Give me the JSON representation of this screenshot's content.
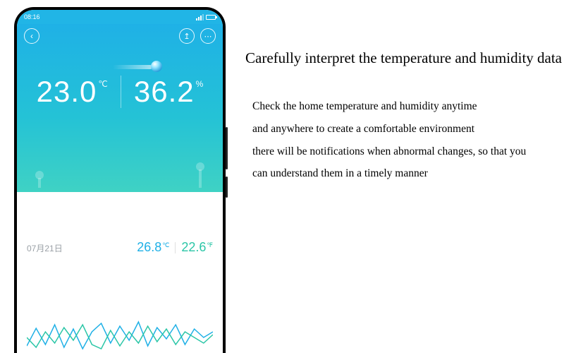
{
  "phone": {
    "status": {
      "time": "08:16"
    },
    "hero": {
      "temperature": {
        "value": "23.0",
        "unit": "℃"
      },
      "humidity": {
        "value": "36.2",
        "unit": "%"
      }
    },
    "footer": {
      "date": "07月21日",
      "temp": {
        "value": "26.8",
        "unit": "℃"
      },
      "hum": {
        "value": "22.6",
        "unit": "℉"
      }
    }
  },
  "copy": {
    "headline": "Carefully interpret the temperature and humidity data",
    "lines": {
      "l1": "Check the home temperature and humidity anytime",
      "l2": "and anywhere to create a comfortable environment",
      "l3": "there will be notifications when abnormal changes, so that you",
      "l4": "can understand them in a timely manner"
    }
  },
  "chart_data": {
    "type": "line",
    "series": [
      {
        "name": "blue",
        "color": "#1fb0e6",
        "values": [
          10,
          35,
          12,
          40,
          8,
          34,
          6,
          30,
          42,
          14,
          38,
          18,
          44,
          10,
          36,
          20,
          40,
          12,
          34,
          22,
          30
        ]
      },
      {
        "name": "green",
        "color": "#2bc6a7",
        "values": [
          22,
          8,
          30,
          14,
          36,
          18,
          40,
          12,
          6,
          32,
          10,
          30,
          14,
          38,
          16,
          34,
          12,
          30,
          22,
          14,
          26
        ]
      }
    ],
    "xlabel": "",
    "ylabel": "",
    "ylim": [
      0,
      60
    ]
  }
}
